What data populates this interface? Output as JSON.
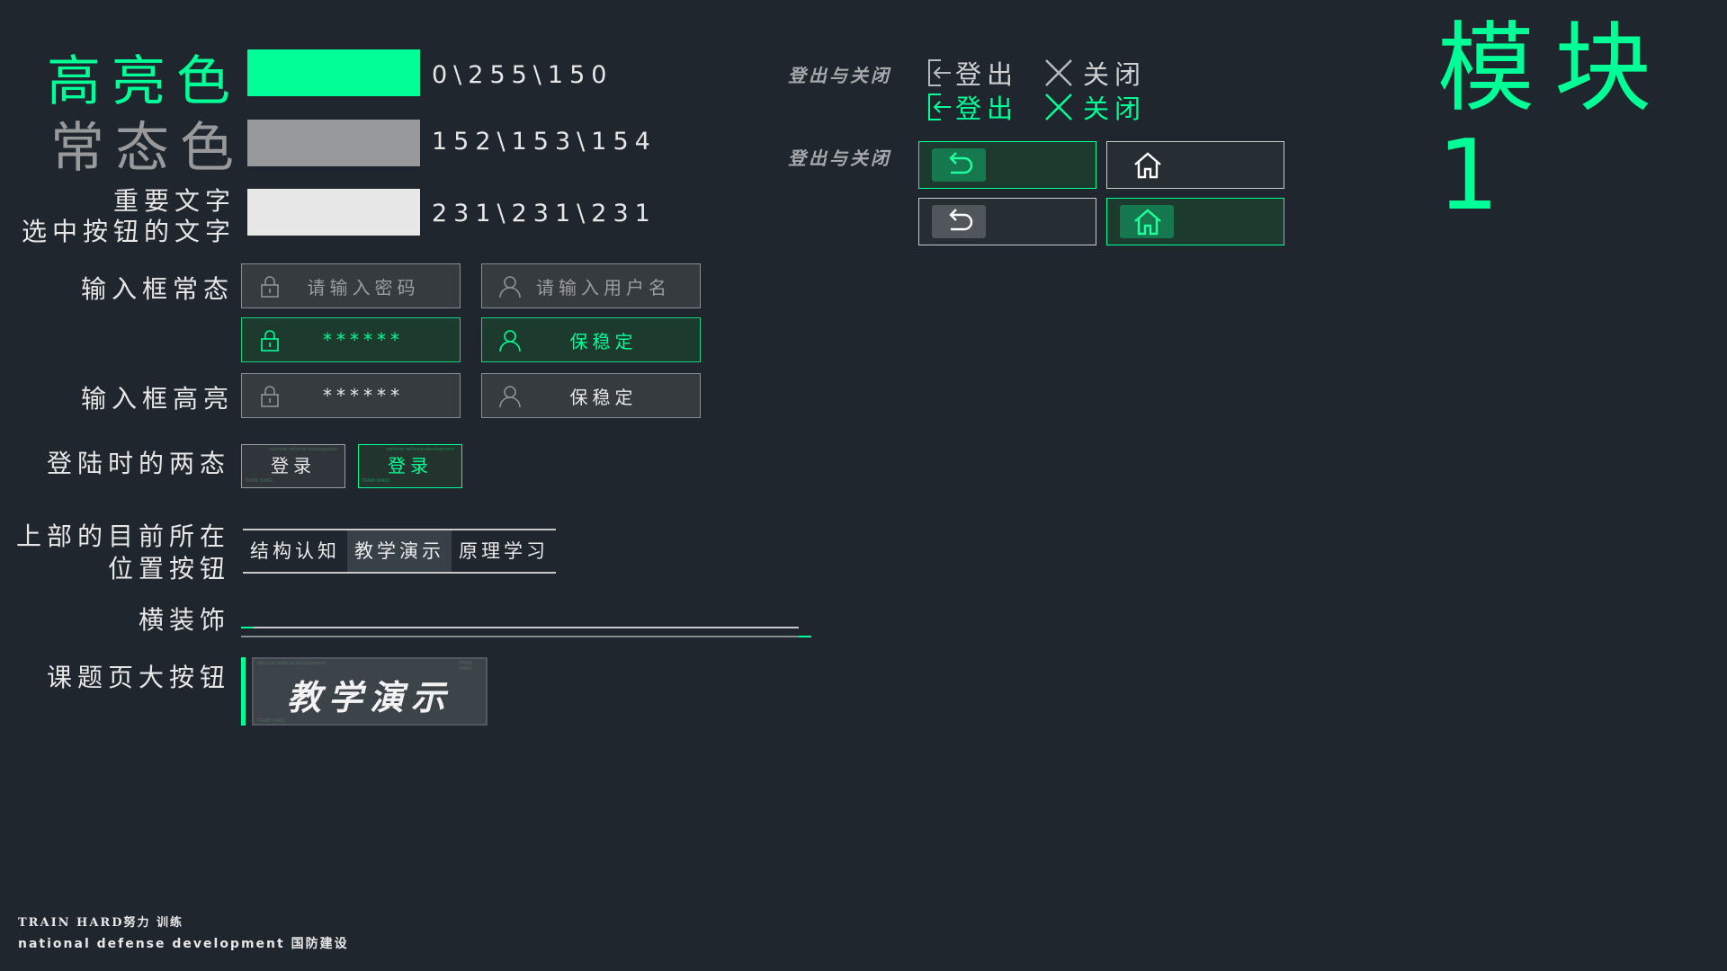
{
  "module_title": "模块1",
  "colors": {
    "highlight": {
      "label": "高亮色",
      "value": "0\\255\\150",
      "hex": "#00ff96"
    },
    "normal": {
      "label": "常态色",
      "value": "152\\153\\154",
      "hex": "#98999a"
    },
    "important_text": {
      "label_line1": "重要文字",
      "label_line2": "选中按钮的文字",
      "value": "231\\231\\231",
      "hex": "#e7e7e7"
    }
  },
  "inputs": {
    "normal_label": "输入框常态",
    "highlight_label": "输入框高亮",
    "password_placeholder": "请输入密码",
    "username_placeholder": "请输入用户名",
    "password_value": "******",
    "username_value": "保稳定"
  },
  "login": {
    "label": "登陆时的两态",
    "button_label": "登录",
    "tiny_top": "national defense development",
    "tiny_bottom": "TRAIN HARD"
  },
  "tabs": {
    "label_line1": "上部的目前所在",
    "label_line2": "位置按钮",
    "items": [
      "结构认知",
      "教学演示",
      "原理学习"
    ],
    "selected": 1
  },
  "decoration": {
    "label": "横装饰"
  },
  "topic_button": {
    "label": "课题页大按钮",
    "text": "教学演示",
    "tiny_top": "national defense development",
    "tiny_right": "TRAIN HARD",
    "tiny_bottom": "TRAIN HARD"
  },
  "right": {
    "header1": "登出与关闭",
    "header2": "登出与关闭",
    "logout_label": "登出",
    "close_label": "关闭"
  },
  "footer": {
    "line1": "TRAIN HARD努力 训练",
    "line2": "national defense development 国防建设"
  }
}
